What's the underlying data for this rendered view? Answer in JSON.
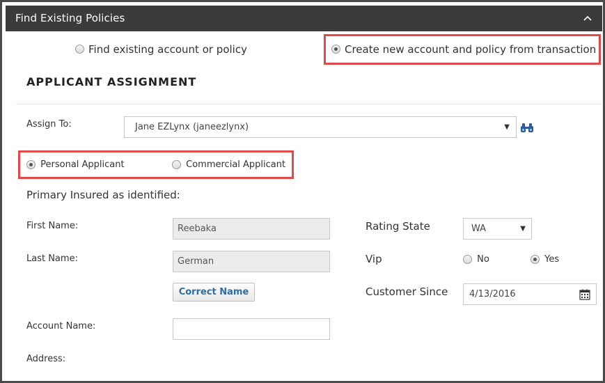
{
  "panel": {
    "title": "Find Existing Policies",
    "collapse_icon": "chevron-up-icon"
  },
  "mode": {
    "find_existing_label": "Find existing account or policy",
    "create_new_label": "Create new account and policy from transaction",
    "selected": "create_new"
  },
  "section": {
    "title": "APPLICANT ASSIGNMENT"
  },
  "assign": {
    "label": "Assign To:",
    "value": "Jane EZLynx (janeezlynx)",
    "search_icon": "binoculars-icon"
  },
  "applicant_type": {
    "personal_label": "Personal Applicant",
    "commercial_label": "Commercial Applicant",
    "selected": "personal"
  },
  "primary": {
    "heading": "Primary Insured as identified:",
    "first_name_label": "First Name:",
    "first_name_value": "Reebaka",
    "last_name_label": "Last Name:",
    "last_name_value": "German",
    "correct_name_button": "Correct Name",
    "account_name_label": "Account Name:",
    "account_name_value": "",
    "address_label": "Address:"
  },
  "right": {
    "rating_state_label": "Rating State",
    "rating_state_value": "WA",
    "vip_label": "Vip",
    "vip_no": "No",
    "vip_yes": "Yes",
    "vip_selected": "yes",
    "customer_since_label": "Customer Since",
    "customer_since_value": "4/13/2016",
    "calendar_icon": "calendar-icon"
  },
  "colors": {
    "header_bg": "#3b3b3b",
    "highlight": "#e04a4a",
    "link_blue": "#2e6da4"
  }
}
